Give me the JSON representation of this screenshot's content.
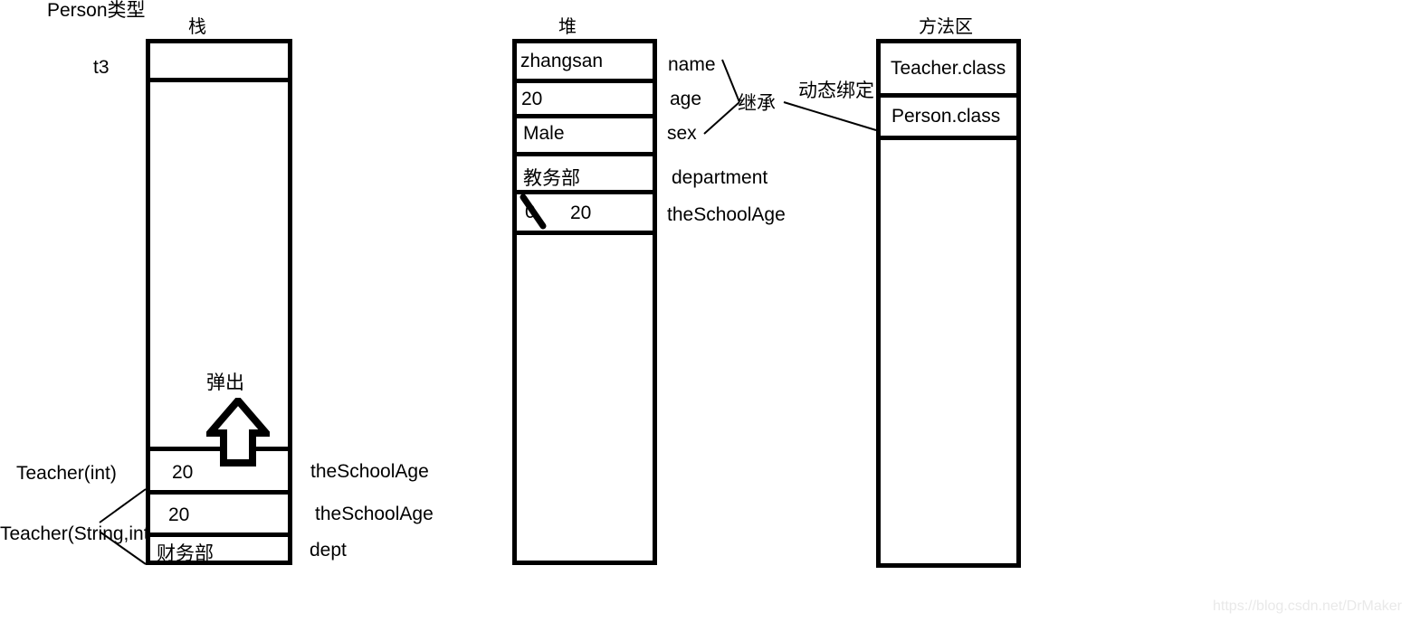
{
  "diagram": {
    "title_hint": "Java memory model: stack, heap, method area",
    "watermark": "https://blog.csdn.net/DrMaker"
  },
  "labels": {
    "person_type": "Person类型",
    "t3": "t3",
    "teacher_int": "Teacher(int)",
    "teacher_string_int": "Teacher(String,int)",
    "pop_out": "弹出",
    "inherit": "继承",
    "dynamic_binding": "动态绑定"
  },
  "stack": {
    "title": "栈",
    "rows": [
      {
        "value": "",
        "annotation": ""
      },
      {
        "value": "",
        "annotation": ""
      },
      {
        "value": "20",
        "annotation": "theSchoolAge"
      },
      {
        "value": "20",
        "annotation": "theSchoolAge"
      },
      {
        "value": "财务部",
        "annotation": "dept"
      }
    ]
  },
  "heap": {
    "title": "堆",
    "rows": [
      {
        "value": "zhangsan",
        "annotation": "name"
      },
      {
        "value": "20",
        "annotation": "age"
      },
      {
        "value": "Male",
        "annotation": "sex"
      },
      {
        "value": "教务部",
        "annotation": "department"
      },
      {
        "value": "20",
        "old_value": "0",
        "annotation": "theSchoolAge"
      },
      {
        "value": "",
        "annotation": ""
      }
    ]
  },
  "method_area": {
    "title": "方法区",
    "rows": [
      {
        "value": "Teacher.class"
      },
      {
        "value": "Person.class"
      },
      {
        "value": ""
      }
    ]
  },
  "colors": {
    "stroke": "#000000",
    "background": "#ffffff",
    "watermark": "#e9e9e9"
  }
}
